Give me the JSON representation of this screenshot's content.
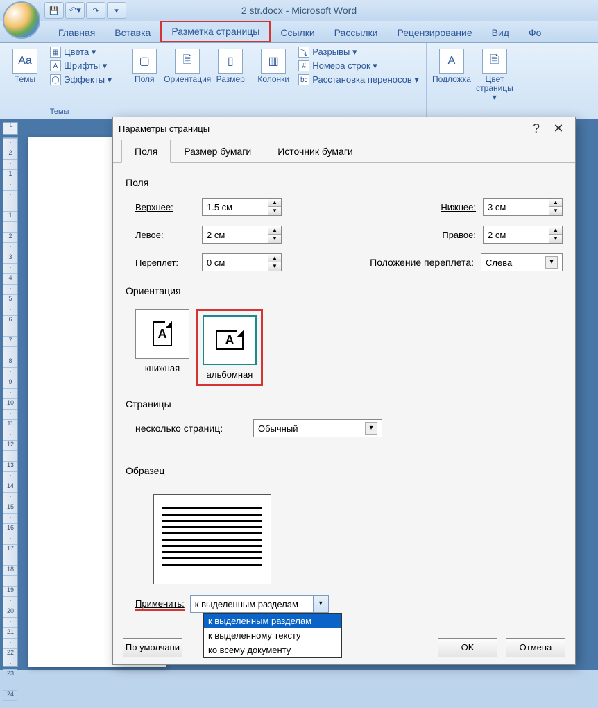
{
  "title": "2 str.docx - Microsoft Word",
  "qat": {
    "save": "💾",
    "undo": "↶",
    "redo": "↷",
    "chev": "▾",
    "sep": "⎯"
  },
  "tabs": [
    "Главная",
    "Вставка",
    "Разметка страницы",
    "Ссылки",
    "Рассылки",
    "Рецензирование",
    "Вид",
    "Фо"
  ],
  "highlighted_tab": 2,
  "ribbon": {
    "themes": {
      "big": "Темы",
      "color": "Цвета ▾",
      "fonts": "Шрифты ▾",
      "fx": "Эффекты ▾",
      "group": "Темы"
    },
    "page_setup": {
      "margins": "Поля",
      "orientation": "Ориентация",
      "size": "Размер",
      "columns": "Колонки",
      "breaks": "Разрывы ▾",
      "line_num": "Номера строк ▾",
      "hyphen": "Расстановка переносов ▾"
    },
    "page_bg": {
      "watermark": "Подложка",
      "page_color": "Цвет страницы ▾"
    }
  },
  "ruler_corner": "└",
  "vruler_ticks": [
    "·",
    "2",
    "·",
    "1",
    "·",
    "·",
    "·",
    "1",
    "·",
    "2",
    "·",
    "3",
    "·",
    "4",
    "·",
    "5",
    "·",
    "6",
    "·",
    "7",
    "·",
    "8",
    "·",
    "9",
    "·",
    "10",
    "·",
    "11",
    "·",
    "12",
    "·",
    "13",
    "·",
    "14",
    "·",
    "15",
    "·",
    "16",
    "·",
    "17",
    "·",
    "18",
    "·",
    "19",
    "·",
    "20",
    "·",
    "21",
    "·",
    "22",
    "·",
    "23",
    "·",
    "24",
    "·"
  ],
  "dialog": {
    "title": "Параметры страницы",
    "help": "?",
    "close": "✕",
    "tabs": [
      "Поля",
      "Размер бумаги",
      "Источник бумаги"
    ],
    "active_tab": 0,
    "fields": {
      "section_margins": "Поля",
      "top_l": "Верхнее:",
      "top_v": "1.5 см",
      "bot_l": "Нижнее:",
      "bot_v": "3 см",
      "left_l": "Левое:",
      "left_v": "2 см",
      "right_l": "Правое:",
      "right_v": "2 см",
      "gutter_l": "Переплет:",
      "gutter_v": "0 см",
      "gutter_pos_l": "Положение переплета:",
      "gutter_pos_v": "Слева"
    },
    "orientation": {
      "section": "Ориентация",
      "portrait": "книжная",
      "landscape": "альбомная",
      "selected": "landscape"
    },
    "pages": {
      "section": "Страницы",
      "multi_l": "несколько страниц:",
      "multi_v": "Обычный"
    },
    "sample": {
      "section": "Образец"
    },
    "apply": {
      "label": "Применить:",
      "value": "к выделенным разделам",
      "options": [
        "к выделенным разделам",
        "к выделенному тексту",
        "ко всему документу"
      ],
      "selected_index": 0
    },
    "footer": {
      "default": "По умолчани",
      "ok": "OK",
      "cancel": "Отмена"
    }
  }
}
